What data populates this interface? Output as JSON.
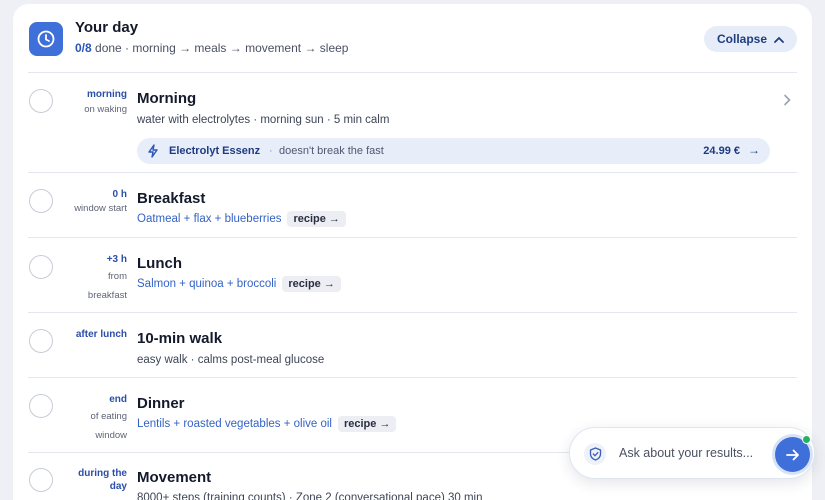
{
  "header": {
    "title": "Your day",
    "done_count": "0/8",
    "subtitle": "done · morning → meals → movement → sleep",
    "collapse_label": "Collapse"
  },
  "rows": [
    {
      "when": "morning",
      "when_sub": "on waking",
      "title": "Morning",
      "detail": "water with electrolytes · morning sun · 5 min calm",
      "product": {
        "name": "Electrolyt Essenz",
        "separator": "·",
        "note": "doesn't break the fast",
        "price": "24.99 €",
        "arrow": "→"
      }
    },
    {
      "when": "0 h",
      "when_sub": "window start",
      "title": "Breakfast",
      "food": "Oatmeal + flax + blueberries",
      "recipe": "recipe →"
    },
    {
      "when": "+3 h",
      "when_sub_1": "from",
      "when_sub_2": "breakfast",
      "title": "Lunch",
      "food": "Salmon + quinoa + broccoli",
      "recipe": "recipe →"
    },
    {
      "when": "after lunch",
      "title": "10-min walk",
      "detail": "easy walk · calms post-meal glucose"
    },
    {
      "when": "end",
      "when_sub_1": "of eating",
      "when_sub_2": "window",
      "title": "Dinner",
      "food": "Lentils + roasted vegetables + olive oil",
      "recipe": "recipe →"
    },
    {
      "when_1": "during the",
      "when_2": "day",
      "title": "Movement",
      "detail": "8000+ steps (training counts) · Zone 2 (conversational pace) 30 min"
    }
  ],
  "ask": {
    "placeholder": "Ask about your results..."
  },
  "colors": {
    "accent": "#3f6fd8",
    "online": "#22b35e"
  },
  "icons": {
    "header": "clock-icon",
    "product": "bolt-icon",
    "ask": "shield-check-icon",
    "send": "arrow-right-icon"
  }
}
